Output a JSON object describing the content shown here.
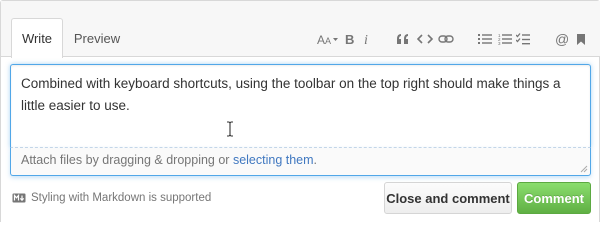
{
  "tabs": [
    {
      "label": "Write",
      "active": true
    },
    {
      "label": "Preview",
      "active": false
    }
  ],
  "toolbar": {
    "icons": [
      "text-size-icon",
      "bold-icon",
      "italic-icon",
      "quote-icon",
      "code-icon",
      "link-icon",
      "unordered-list-icon",
      "ordered-list-icon",
      "task-list-icon",
      "mention-icon",
      "bookmark-icon"
    ]
  },
  "editor": {
    "text": "Combined with keyboard shortcuts, using the toolbar on the top right should make things a little easier to use."
  },
  "attach": {
    "prefix": "Attach files by dragging & dropping or ",
    "link": "selecting them",
    "suffix": "."
  },
  "footer": {
    "markdown_note": "Styling with Markdown is supported",
    "close_button": "Close and comment",
    "comment_button": "Comment"
  },
  "colors": {
    "focus_border": "#51a7e8",
    "link": "#4078c0",
    "primary_button": "#6cc644"
  }
}
